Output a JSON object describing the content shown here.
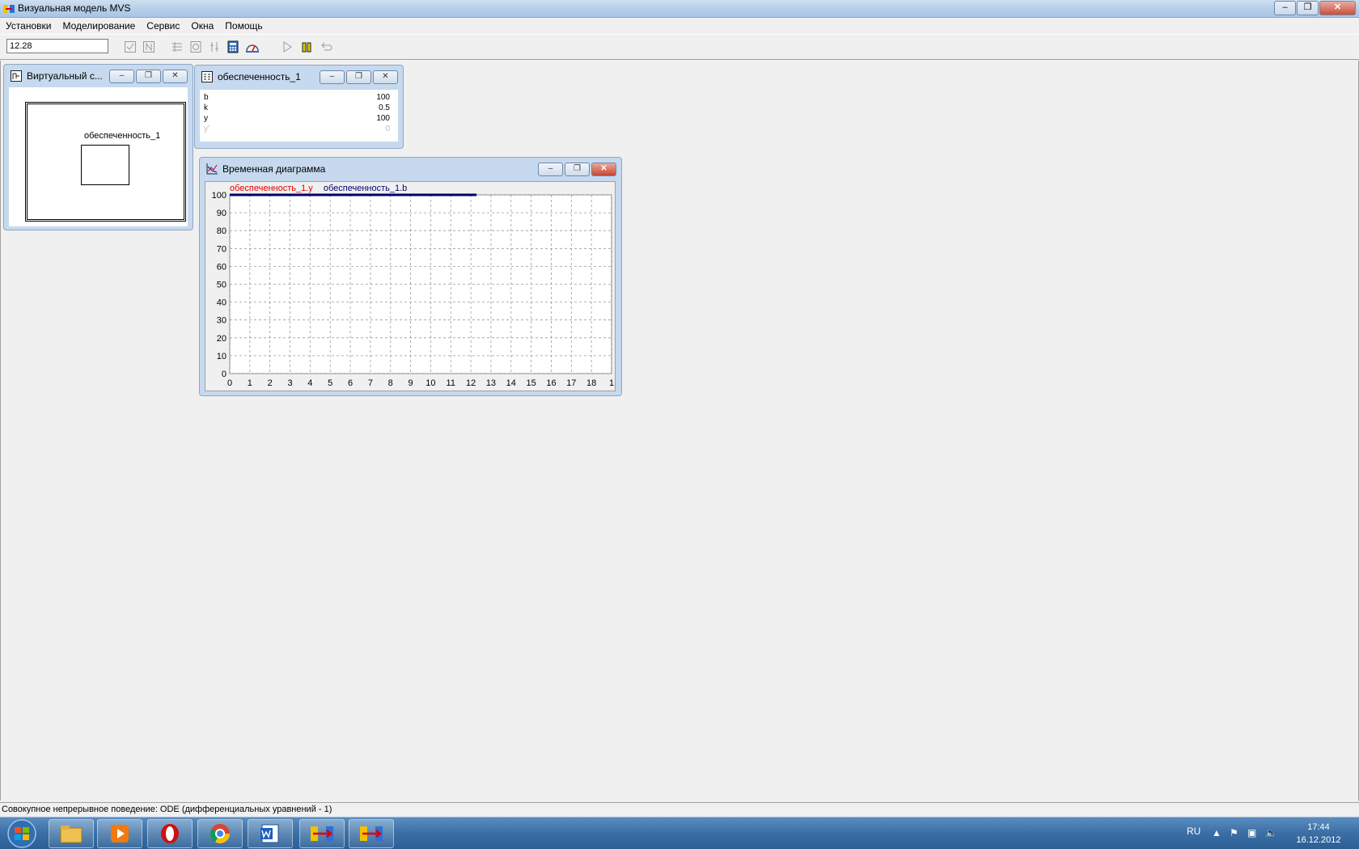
{
  "app": {
    "title": "Визуальная модель MVS"
  },
  "menu": [
    "Установки",
    "Моделирование",
    "Сервис",
    "Окна",
    "Помощь"
  ],
  "toolbar": {
    "time_value": "12.28"
  },
  "virtual_window": {
    "title": "Виртуальный с...",
    "block_label": "обеспеченность_1"
  },
  "vars_window": {
    "title": "обеспеченность_1",
    "rows": [
      {
        "name": "b",
        "value": "100"
      },
      {
        "name": "k",
        "value": "0.5"
      },
      {
        "name": "y",
        "value": "100"
      },
      {
        "name": "y'",
        "value": "0"
      }
    ]
  },
  "chart_window": {
    "title": "Временная диаграмма"
  },
  "chart_data": {
    "type": "line",
    "x_ticks": [
      "0",
      "1",
      "2",
      "3",
      "4",
      "5",
      "6",
      "7",
      "8",
      "9",
      "10",
      "11",
      "12",
      "13",
      "14",
      "15",
      "16",
      "17",
      "18",
      "1"
    ],
    "y_ticks": [
      "100",
      "90",
      "80",
      "70",
      "60",
      "50",
      "40",
      "30",
      "20",
      "10",
      "0"
    ],
    "xlim": [
      0,
      19
    ],
    "ylim": [
      0,
      100
    ],
    "grid": true,
    "legend_position": "top-left",
    "series": [
      {
        "name": "обеспеченность_1.y",
        "color": "#e00000",
        "x": [
          0,
          12.28
        ],
        "y": [
          100,
          100
        ]
      },
      {
        "name": "обеспеченность_1.b",
        "color": "#00006e",
        "x": [
          0,
          12.28
        ],
        "y": [
          100,
          100
        ]
      }
    ]
  },
  "status": {
    "text": "Совокупное непрерывное поведение: ODE (дифференциальных уравнений - 1)"
  },
  "taskbar": {
    "language": "RU",
    "time": "17:44",
    "date": "16.12.2012"
  }
}
